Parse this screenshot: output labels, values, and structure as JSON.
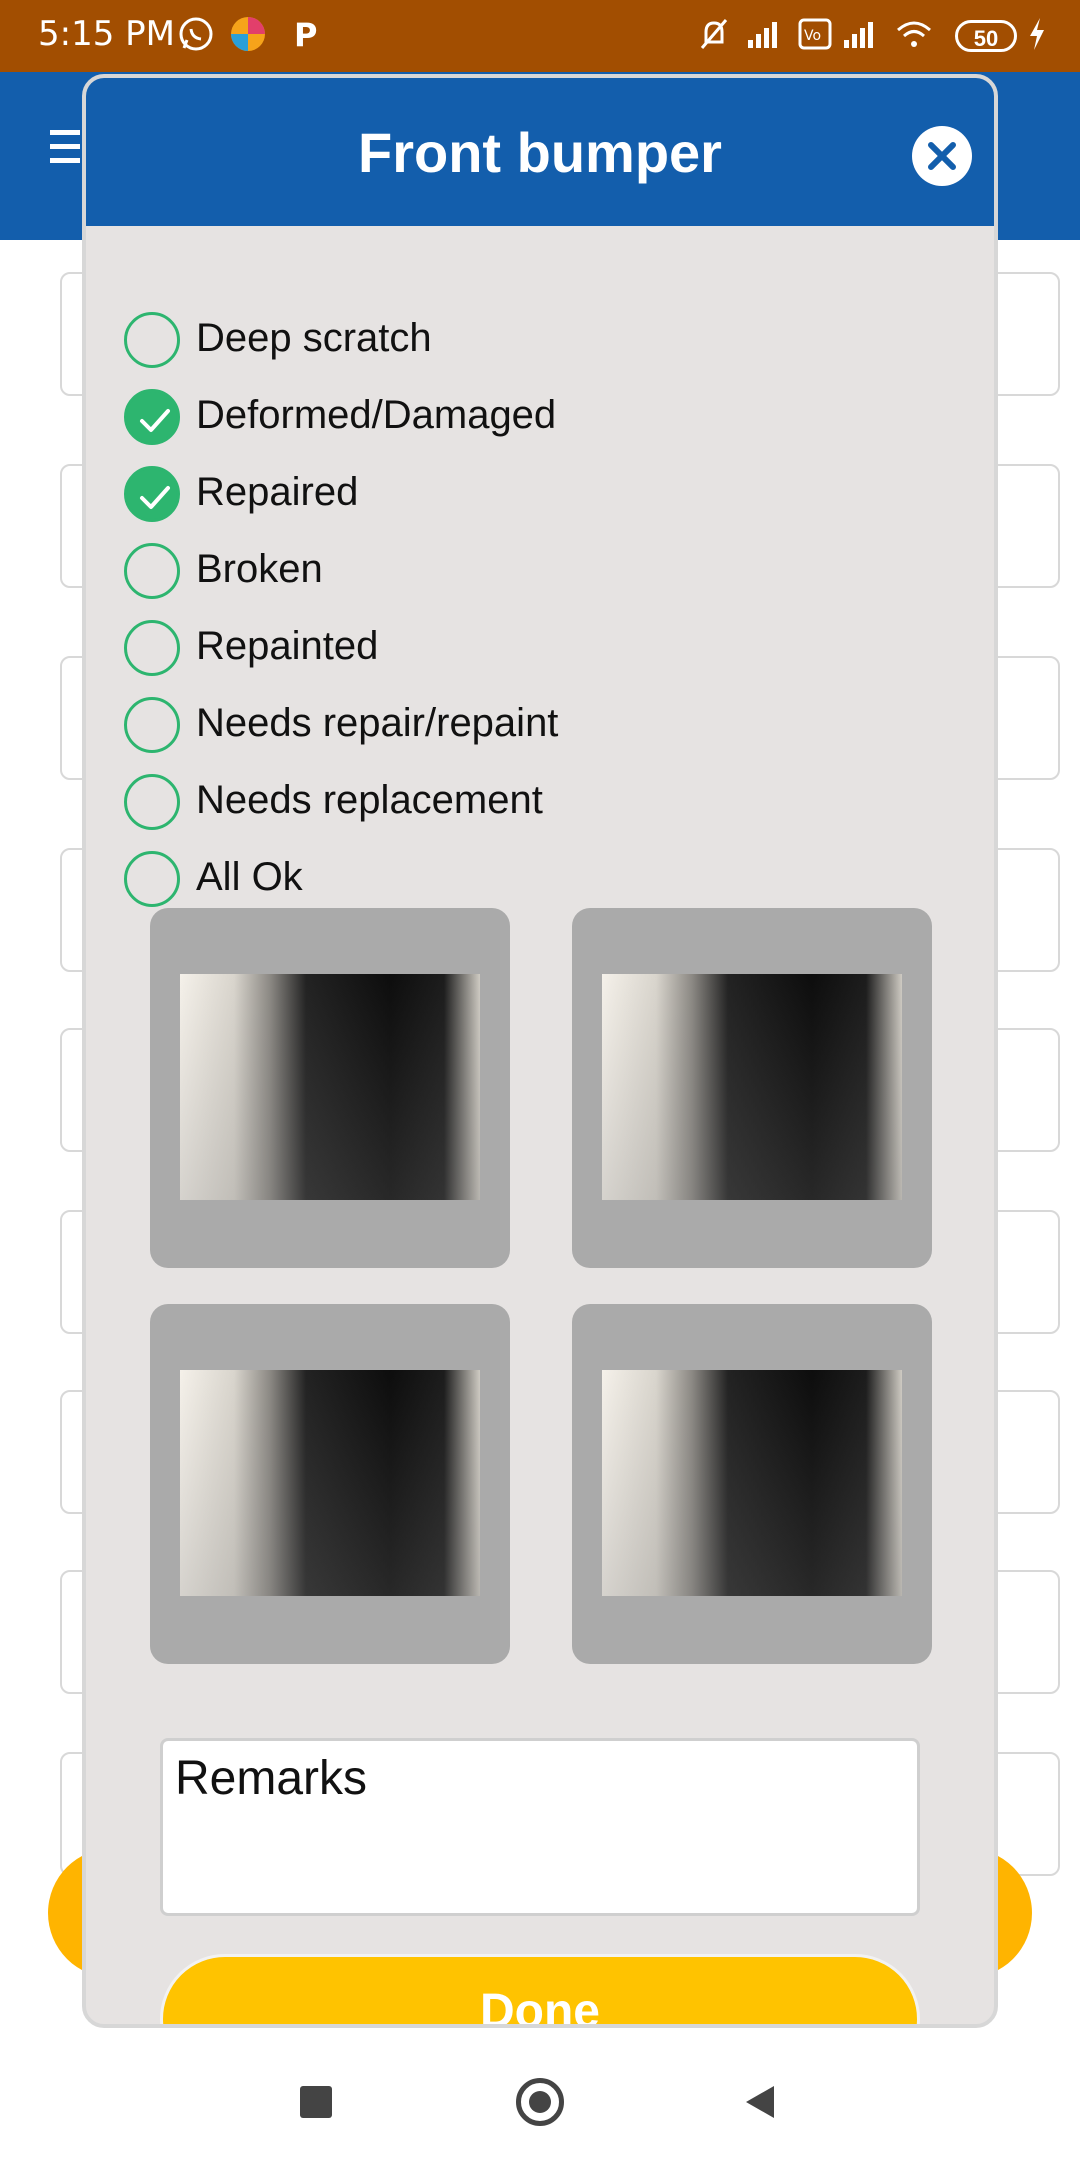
{
  "status_bar": {
    "time": "5:15 PM",
    "battery": "50"
  },
  "dialog": {
    "title": "Front bumper",
    "options": [
      {
        "label": "Deep scratch",
        "checked": false
      },
      {
        "label": "Deformed/Damaged",
        "checked": true
      },
      {
        "label": "Repaired",
        "checked": true
      },
      {
        "label": "Broken",
        "checked": false
      },
      {
        "label": "Repainted",
        "checked": false
      },
      {
        "label": "Needs repair/repaint",
        "checked": false
      },
      {
        "label": "Needs replacement",
        "checked": false
      },
      {
        "label": "All Ok",
        "checked": false
      }
    ],
    "remarks_placeholder": "Remarks",
    "done_label": "Done"
  },
  "colors": {
    "status_bar": "#a24e01",
    "primary": "#135eac",
    "check_green": "#2db56f",
    "accent_yellow": "#ffc300"
  }
}
